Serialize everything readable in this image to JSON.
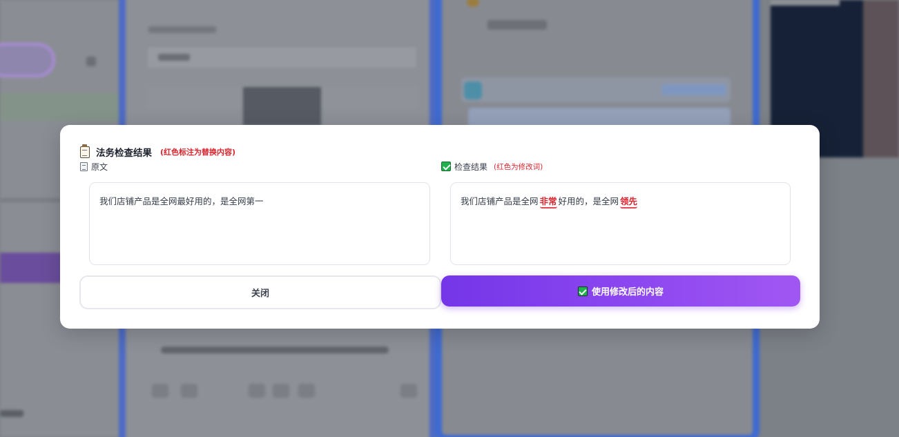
{
  "modal": {
    "title": "法务检查结果",
    "title_note": "(红色标注为替换内容)",
    "original": {
      "label": "原文",
      "text": "我们店铺产品是全网最好用的，是全网第一"
    },
    "result": {
      "label": "检查结果",
      "note": "(红色为修改词)",
      "segments": [
        "我们店铺产品是全网",
        "非常",
        "好用的，是全网",
        "领先"
      ],
      "highlighted_words": [
        "非常",
        "领先"
      ],
      "highlight_color": "#d9232d"
    },
    "buttons": {
      "close_label": "关闭",
      "apply_label": "使用修改后的内容"
    },
    "icons": {
      "title": "clipboard-icon",
      "original": "document-icon",
      "result": "check-mark-icon",
      "apply": "check-mark-icon"
    },
    "accent_color": "#7c3aed"
  }
}
